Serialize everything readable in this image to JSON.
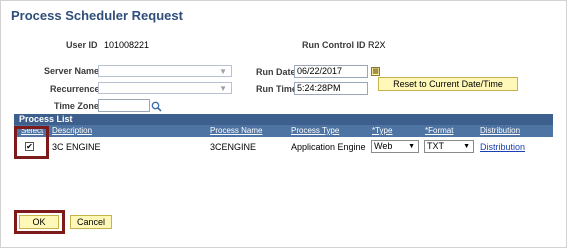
{
  "page": {
    "title": "Process Scheduler Request"
  },
  "user": {
    "label": "User ID",
    "value": "101008221"
  },
  "run_control": {
    "label": "Run Control ID",
    "value": "R2X"
  },
  "server": {
    "label": "Server Name",
    "value": ""
  },
  "recurrence": {
    "label": "Recurrence",
    "value": ""
  },
  "time_zone": {
    "label": "Time Zone",
    "value": ""
  },
  "run_date": {
    "label": "Run Date",
    "value": "06/22/2017"
  },
  "run_time": {
    "label": "Run Time",
    "value": "5:24:28PM"
  },
  "reset_button": "Reset to Current Date/Time",
  "process_list": {
    "title": "Process List",
    "headers": {
      "select": "Select",
      "description": "Description",
      "process_name": "Process Name",
      "process_type": "Process Type",
      "type": "*Type",
      "format": "*Format",
      "distribution": "Distribution"
    },
    "rows": [
      {
        "selected": true,
        "description": "3C ENGINE",
        "process_name": "3CENGINE",
        "process_type": "Application Engine",
        "type": "Web",
        "format": "TXT",
        "distribution": "Distribution"
      }
    ]
  },
  "buttons": {
    "ok": "OK",
    "cancel": "Cancel"
  },
  "icons": {
    "calendar": "calendar-icon",
    "search": "magnifier-icon",
    "dropdown": "chevron-down-icon"
  },
  "colors": {
    "title": "#2f4f7a",
    "grid_header": "#4e74a3",
    "highlight": "#7d1a1a",
    "button": "#fff8b8"
  }
}
